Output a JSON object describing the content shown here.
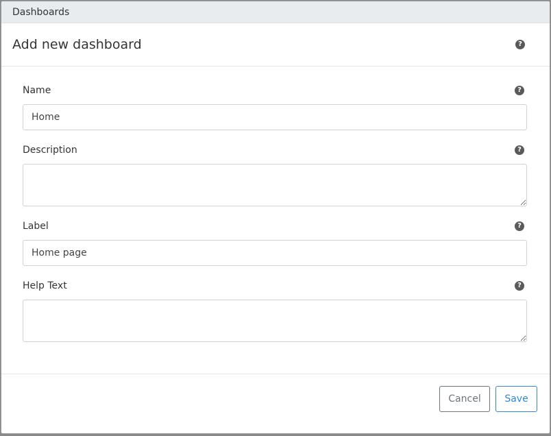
{
  "window": {
    "title": "Dashboards"
  },
  "modal": {
    "title": "Add new dashboard",
    "fields": [
      {
        "label": "Name",
        "value": "Home",
        "type": "input"
      },
      {
        "label": "Description",
        "value": "",
        "type": "textarea"
      },
      {
        "label": "Label",
        "value": "Home page",
        "type": "input"
      },
      {
        "label": "Help Text",
        "value": "",
        "type": "textarea"
      }
    ],
    "footer": {
      "cancel_label": "Cancel",
      "save_label": "Save"
    }
  },
  "icons": {
    "help": "question-circle-icon"
  },
  "colors": {
    "save_accent": "#2f86d6",
    "cancel_border": "#6c757d",
    "titlebar_bg": "#e9ecef"
  }
}
